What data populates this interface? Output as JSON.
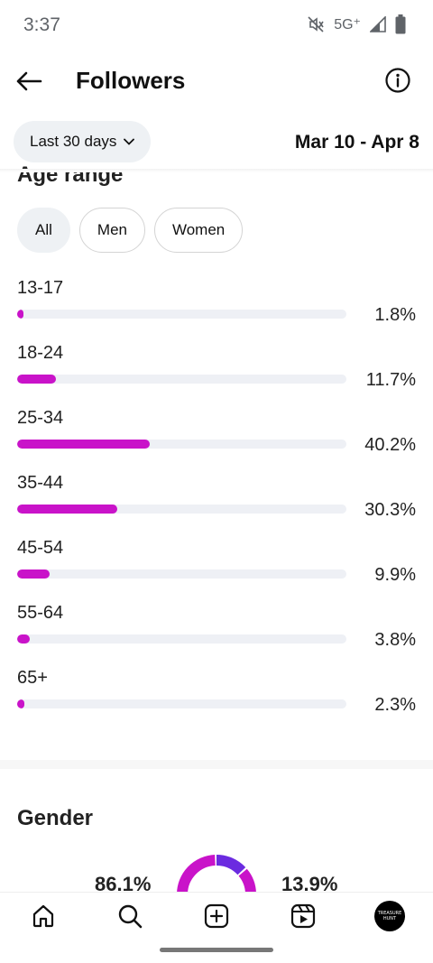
{
  "status": {
    "time": "3:37",
    "network": "5G⁺"
  },
  "header": {
    "title": "Followers"
  },
  "filters": {
    "period": "Last 30 days",
    "date_range": "Mar 10 - Apr 8"
  },
  "age_section": {
    "title": "Age range",
    "segments": [
      "All",
      "Men",
      "Women"
    ],
    "selected_segment": "All",
    "rows": [
      {
        "label": "13-17",
        "value": 1.8,
        "pct": "1.8%"
      },
      {
        "label": "18-24",
        "value": 11.7,
        "pct": "11.7%"
      },
      {
        "label": "25-34",
        "value": 40.2,
        "pct": "40.2%"
      },
      {
        "label": "35-44",
        "value": 30.3,
        "pct": "30.3%"
      },
      {
        "label": "45-54",
        "value": 9.9,
        "pct": "9.9%"
      },
      {
        "label": "55-64",
        "value": 3.8,
        "pct": "3.8%"
      },
      {
        "label": "65+",
        "value": 2.3,
        "pct": "2.3%"
      }
    ]
  },
  "gender_section": {
    "title": "Gender",
    "left_pct": "86.1%",
    "right_pct": "13.9%",
    "left_value": 86.1,
    "right_value": 13.9
  },
  "nav": {
    "items": [
      "home-icon",
      "search-icon",
      "create-icon",
      "reels-icon",
      "profile-avatar"
    ],
    "profile_text": "TREASURE HUNT"
  },
  "colors": {
    "accent": "#c913c9",
    "secondary": "#6b2be0",
    "track": "#eef0f5",
    "chip": "#eef1f4"
  }
}
